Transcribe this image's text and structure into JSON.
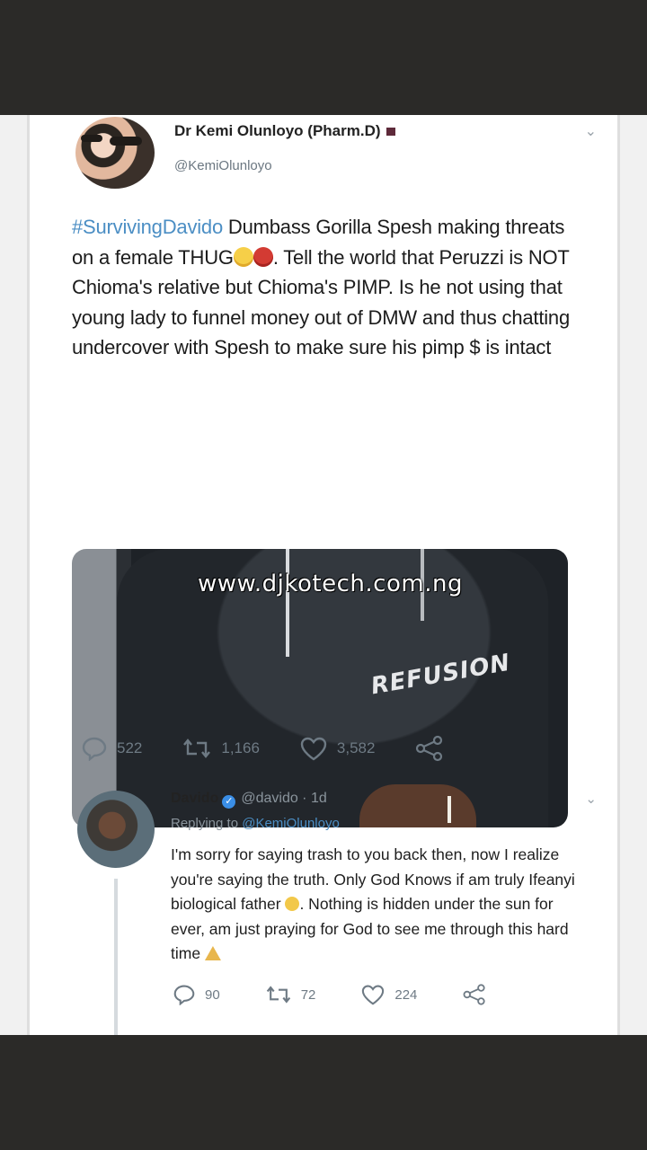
{
  "tweet1": {
    "author_name": "Dr Kemi Olunloyo (Pharm.D)",
    "handle": "@KemiOlunloyo",
    "hashtag": "#SurvivingDavido",
    "text_part1": " Dumbass Gorilla Spesh making threats on a female THUG",
    "text_part2": ". Tell the world that Peruzzi is NOT Chioma's relative but Chioma's PIMP. Is he not using that young lady to funnel money out of DMW and thus chatting undercover with Spesh to make sure his pimp $ is intact",
    "media": {
      "watermark": "www.djkotech.com.ng",
      "logo_text": "REFUSION"
    },
    "stats": {
      "replies": "522",
      "retweets": "1,166",
      "likes": "3,582"
    }
  },
  "tweet2": {
    "author_name": "Davido",
    "handle": "@davido",
    "time": "1d",
    "replying_prefix": "Replying to ",
    "replying_to": "@KemiOlunloyo",
    "text_part1": "I'm sorry for saying trash to you back then, now I realize you're saying the truth. Only God Knows if am truly Ifeanyi biological father ",
    "text_part2": ". Nothing is hidden under the sun for ever, am just praying for God to see me through this hard time",
    "stats": {
      "replies": "90",
      "retweets": "72",
      "likes": "224"
    }
  },
  "icons": [
    "reply-icon",
    "retweet-icon",
    "like-icon",
    "share-icon",
    "chevron-down-icon",
    "verified-icon",
    "flag-icon"
  ],
  "colors": {
    "link": "#4b8ec4",
    "muted": "#6e7a84",
    "verified": "#3a8ee6",
    "frame": "#2b2a28"
  }
}
